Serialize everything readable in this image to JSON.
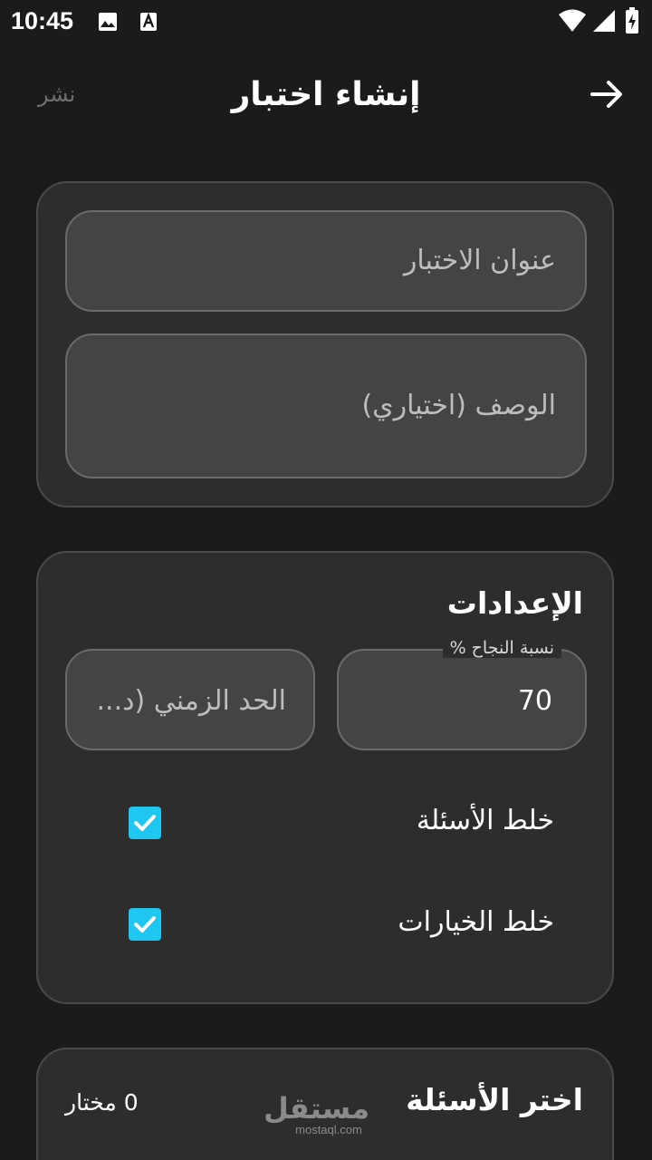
{
  "status_bar": {
    "time": "10:45"
  },
  "header": {
    "title": "إنشاء اختبار",
    "publish_label": "نشر",
    "back_icon": "arrow-right-icon"
  },
  "details": {
    "title_placeholder": "عنوان الاختبار",
    "description_placeholder": "الوصف (اختياري)"
  },
  "settings": {
    "title": "الإعدادات",
    "pass_rate_label": "نسبة النجاح %",
    "pass_rate_value": "70",
    "time_limit_placeholder": "الحد الزمني (د...",
    "shuffle_questions_label": "خلط الأسئلة",
    "shuffle_questions_checked": true,
    "shuffle_options_label": "خلط الخيارات",
    "shuffle_options_checked": true
  },
  "questions": {
    "title": "اختر الأسئلة",
    "selected_count": "0 مختار"
  },
  "watermark": {
    "arabic": "مستقل",
    "latin": "mostaql.com"
  },
  "colors": {
    "accent": "#1ec6f0",
    "background": "#1b1b1b",
    "card": "#2d2d2d"
  }
}
